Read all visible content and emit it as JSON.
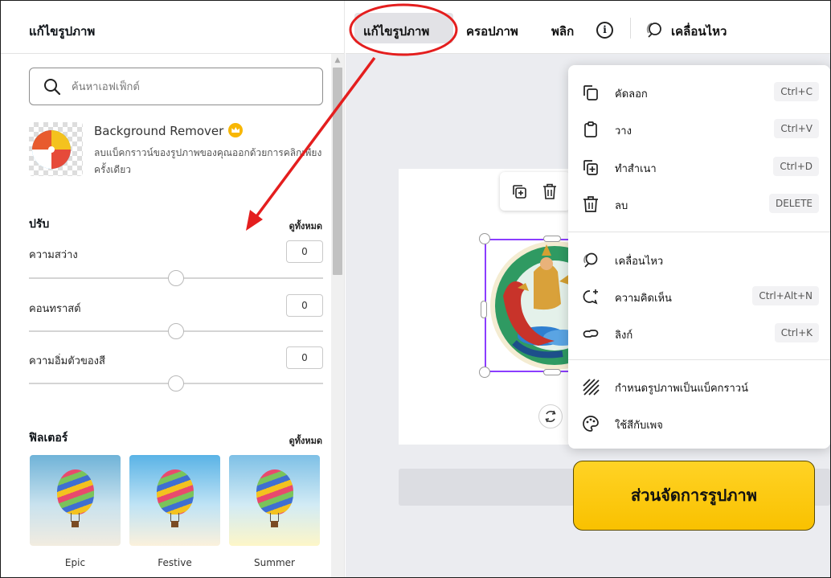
{
  "left_panel": {
    "title": "แก้ไขรูปภาพ",
    "search_placeholder": "ค้นหาเอฟเฟ็กต์",
    "background_remover": {
      "title": "Background Remover",
      "description": "ลบแบ็คกราวน์ของรูปภาพของคุณออกด้วยการคลิกเพียงครั้งเดียว"
    },
    "adjust": {
      "title": "ปรับ",
      "see_all": "ดูทั้งหมด",
      "items": [
        {
          "label": "ความสว่าง",
          "value": "0",
          "slider_fraction": 0.5
        },
        {
          "label": "คอนทราสต์",
          "value": "0",
          "slider_fraction": 0.5
        },
        {
          "label": "ความอิ่มตัวของสี",
          "value": "0",
          "slider_fraction": 0.5
        }
      ]
    },
    "filters": {
      "title": "ฟิลเตอร์",
      "see_all": "ดูทั้งหมด",
      "items": [
        {
          "label": "Epic"
        },
        {
          "label": "Festive"
        },
        {
          "label": "Summer"
        }
      ]
    }
  },
  "toolbar": {
    "edit_image": "แก้ไขรูปภาพ",
    "crop": "ครอปภาพ",
    "flip": "พลิก",
    "info_icon": "i",
    "animate": "เคลื่อนไหว"
  },
  "context_menu": {
    "items": [
      {
        "label": "คัดลอก",
        "shortcut": "Ctrl+C",
        "icon": "copy-icon"
      },
      {
        "label": "วาง",
        "shortcut": "Ctrl+V",
        "icon": "paste-icon"
      },
      {
        "label": "ทำสำเนา",
        "shortcut": "Ctrl+D",
        "icon": "duplicate-icon"
      },
      {
        "label": "ลบ",
        "shortcut": "DELETE",
        "icon": "trash-icon"
      },
      {
        "label": "เคลื่อนไหว",
        "shortcut": "",
        "icon": "animate-icon"
      },
      {
        "label": "ความคิดเห็น",
        "shortcut": "Ctrl+Alt+N",
        "icon": "comment-icon"
      },
      {
        "label": "ลิงก์",
        "shortcut": "Ctrl+K",
        "icon": "link-icon"
      },
      {
        "label": "กำหนดรูปภาพเป็นแบ็คกราวน์",
        "shortcut": "",
        "icon": "set-background-icon"
      },
      {
        "label": "ใช้สีกับเพจ",
        "shortcut": "",
        "icon": "palette-icon"
      }
    ]
  },
  "annotation": {
    "callout": "ส่วนจัดการรูปภาพ"
  },
  "colors": {
    "accent_selection": "#8b3dff",
    "annotation_red": "#e41e1e",
    "callout_yellow": "#f9c100"
  }
}
